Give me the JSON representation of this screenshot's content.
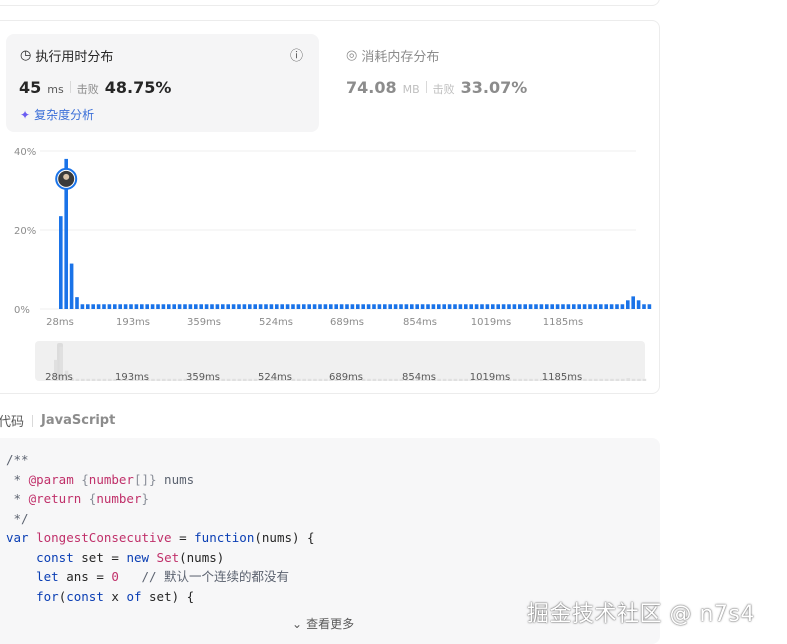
{
  "runtime": {
    "title": "执行用时分布",
    "value": "45",
    "unit": "ms",
    "beat_label": "击败",
    "beat_value": "48.75%",
    "analyze_label": "复杂度分析"
  },
  "memory": {
    "title": "消耗内存分布",
    "value": "74.08",
    "unit": "MB",
    "beat_label": "击败",
    "beat_value": "33.07%"
  },
  "chart_data": {
    "type": "bar",
    "ylabel_ticks": [
      "40%",
      "20%",
      "0%"
    ],
    "ylim": [
      0,
      40
    ],
    "x_tick_labels": [
      "28ms",
      "193ms",
      "359ms",
      "524ms",
      "689ms",
      "854ms",
      "1019ms",
      "1185ms"
    ],
    "values": [
      23.5,
      38,
      11.5,
      3,
      1.2,
      1.2,
      1.2,
      1.2,
      1.2,
      1.2,
      1.2,
      1.2,
      1.2,
      1.2,
      1.2,
      1.2,
      1.2,
      1.2,
      1.2,
      1.2,
      1.2,
      1.2,
      1.2,
      1.2,
      1.2,
      1.2,
      1.2,
      1.2,
      1.2,
      1.2,
      1.2,
      1.2,
      1.2,
      1.2,
      1.2,
      1.2,
      1.2,
      1.2,
      1.2,
      1.2,
      1.2,
      1.2,
      1.2,
      1.2,
      1.2,
      1.2,
      1.2,
      1.2,
      1.2,
      1.2,
      1.2,
      1.2,
      1.2,
      1.2,
      1.2,
      1.2,
      1.2,
      1.2,
      1.2,
      1.2,
      1.2,
      1.2,
      1.2,
      1.2,
      1.2,
      1.2,
      1.2,
      1.2,
      1.2,
      1.2,
      1.2,
      1.2,
      1.2,
      1.2,
      1.2,
      1.2,
      1.2,
      1.2,
      1.2,
      1.2,
      1.2,
      1.2,
      1.2,
      1.2,
      1.2,
      1.2,
      1.2,
      1.2,
      1.2,
      1.2,
      1.2,
      1.2,
      1.2,
      1.2,
      1.2,
      1.2,
      1.2,
      1.2,
      1.2,
      1.2,
      1.2,
      1.2,
      1.2,
      1.2,
      1.2,
      2.2,
      3.2,
      2.2,
      1.2,
      1.2
    ],
    "highlight_index": 1,
    "accent": "#1a73e8"
  },
  "code": {
    "section_label": "代码",
    "language": "JavaScript",
    "more_label": "查看更多"
  },
  "watermark": "掘金技术社区 @ n7s4"
}
